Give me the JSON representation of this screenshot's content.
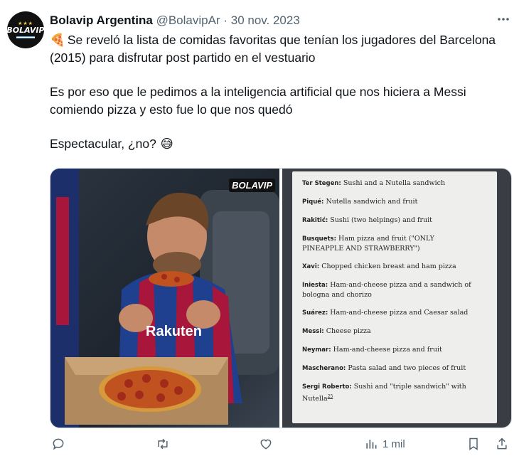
{
  "tweet": {
    "author_name": "Bolavip Argentina",
    "handle": "@BolavipAr",
    "separator": "·",
    "date": "30 nov. 2023",
    "avatar_label": "BOLAVIP",
    "text_line1_emoji": "🍕",
    "text_line1": "Se reveló la lista de comidas favoritas que tenían los jugadores del Barcelona (2015) para disfrutar post partido en el vestuario",
    "text_line2": "Es por eso que le pedimos a la inteligencia artificial que nos hiciera a Messi comiendo pizza y esto fue lo que nos quedó",
    "text_line3": "Espectacular, ¿no?",
    "text_line3_emoji": "😅"
  },
  "media": {
    "watermark": "BOLAVIP",
    "shirt_text": "Rakuten",
    "menu": [
      {
        "name": "Ter Stegen:",
        "food": "Sushi and a Nutella sandwich"
      },
      {
        "name": "Piqué:",
        "food": "Nutella sandwich and fruit"
      },
      {
        "name": "Rakitić:",
        "food": "Sushi (two helpings) and fruit"
      },
      {
        "name": "Busquets:",
        "food": "Ham pizza and fruit (\"ONLY PINEAPPLE AND STRAWBERRY\")"
      },
      {
        "name": "Xavi:",
        "food": "Chopped chicken breast and ham pizza"
      },
      {
        "name": "Iniesta:",
        "food": "Ham-and-cheese pizza and a sandwich of bologna and chorizo"
      },
      {
        "name": "Suárez:",
        "food": "Ham-and-cheese pizza and Caesar salad"
      },
      {
        "name": "Messi:",
        "food": "Cheese pizza"
      },
      {
        "name": "Neymar:",
        "food": "Ham-and-cheese pizza and fruit"
      },
      {
        "name": "Mascherano:",
        "food": "Pasta salad and two pieces of fruit"
      },
      {
        "name": "Sergi Roberto:",
        "food": "Sushi and \"triple sandwich\" with Nutella"
      }
    ],
    "footnote": "25"
  },
  "actions": {
    "views": "1 mil"
  },
  "icons": {
    "more": "more-icon",
    "reply": "reply-icon",
    "retweet": "retweet-icon",
    "like": "like-icon",
    "views": "views-icon",
    "bookmark": "bookmark-icon",
    "share": "share-icon"
  },
  "colors": {
    "text": "#0f1419",
    "muted": "#536471",
    "border": "#cfd9de",
    "barca_blue": "#1f3f8f",
    "barca_red": "#a8163b"
  }
}
